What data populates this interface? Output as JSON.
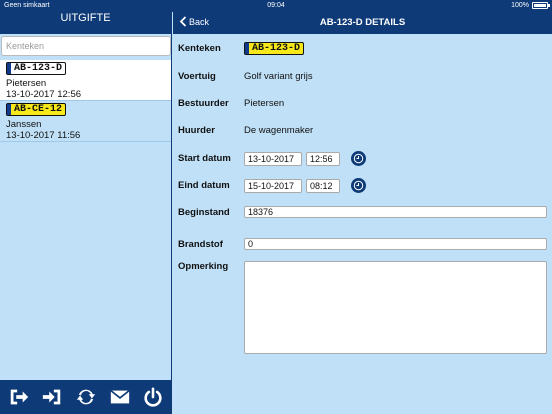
{
  "status_bar": {
    "carrier": "Geen simkaart",
    "time": "09:04",
    "battery_text": "100%",
    "battery_level": 1.0
  },
  "sidebar": {
    "title": "UITGIFTE",
    "search": {
      "placeholder": "Kenteken",
      "value": ""
    },
    "items": [
      {
        "plate": "AB-123-D",
        "name": "Pietersen",
        "datetime": "13-10-2017 12:56",
        "selected": true
      },
      {
        "plate": "AB-CE-12",
        "name": "Janssen",
        "datetime": "13-10-2017 11:56",
        "selected": false
      }
    ],
    "toolbar_icons": [
      "sign-out-icon",
      "sign-in-icon",
      "refresh-icon",
      "envelope-icon",
      "power-icon"
    ]
  },
  "detail": {
    "back_label": "Back",
    "title": "AB-123-D DETAILS",
    "kenteken": {
      "label": "Kenteken",
      "plate": "AB-123-D"
    },
    "voertuig": {
      "label": "Voertuig",
      "value": "Golf variant grijs"
    },
    "bestuurder": {
      "label": "Bestuurder",
      "value": "Pietersen"
    },
    "huurder": {
      "label": "Huurder",
      "value": "De wagenmaker"
    },
    "start": {
      "label": "Start datum",
      "date": "13-10-2017",
      "time": "12:56"
    },
    "end": {
      "label": "Eind datum",
      "date": "15-10-2017",
      "time": "08:12"
    },
    "beginstand": {
      "label": "Beginstand",
      "value": "18376"
    },
    "brandstof": {
      "label": "Brandstof",
      "value": "0"
    },
    "opmerking": {
      "label": "Opmerking",
      "value": ""
    }
  },
  "colors": {
    "nav": "#0e3a78",
    "background": "#bfe0f7",
    "plate_yellow": "#f6e81a",
    "eu_blue": "#123a8c"
  }
}
